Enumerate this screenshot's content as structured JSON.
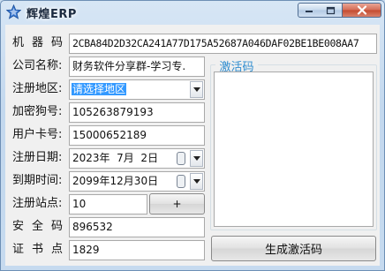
{
  "window": {
    "title": "辉煌ERP",
    "controls": {
      "minimize": "—",
      "maximize": "□",
      "close": "✕"
    }
  },
  "form": {
    "machine_code_label": "机器码:",
    "machine_code_value": "2CBA84D2D32CA241A77D175A52687A046DAF02BE1BE008AA7",
    "company_label": "公司名称:",
    "company_value": "财务软件分享群-学习专.",
    "region_label": "注册地区:",
    "region_value": "请选择地区",
    "dongle_label": "加密狗号:",
    "dongle_value": "105263879193",
    "card_label": "用户卡号:",
    "card_value": "15000652189",
    "reg_date_label": "注册日期:",
    "reg_date_value": "2023年  7月  2日",
    "expire_label": "到期时间:",
    "expire_value": "2099年12月30日",
    "sites_label": "注册站点:",
    "sites_value": "10",
    "plus_button": "+",
    "security_label": "安全码:",
    "security_value": "896532",
    "cert_label": "证书点:",
    "cert_value": "1829"
  },
  "activation": {
    "group_title": "激活码",
    "code_value": "",
    "generate_button": "生成激活码"
  },
  "colors": {
    "accent": "#2e8ccf",
    "selection": "#3399ff",
    "titlebar": "#c3d8ee",
    "close_button": "#c44a2e"
  },
  "icons": [
    "app-star-icon",
    "minimize-icon",
    "maximize-icon",
    "close-icon",
    "dropdown-arrow-icon",
    "calendar-toggle-icon"
  ]
}
